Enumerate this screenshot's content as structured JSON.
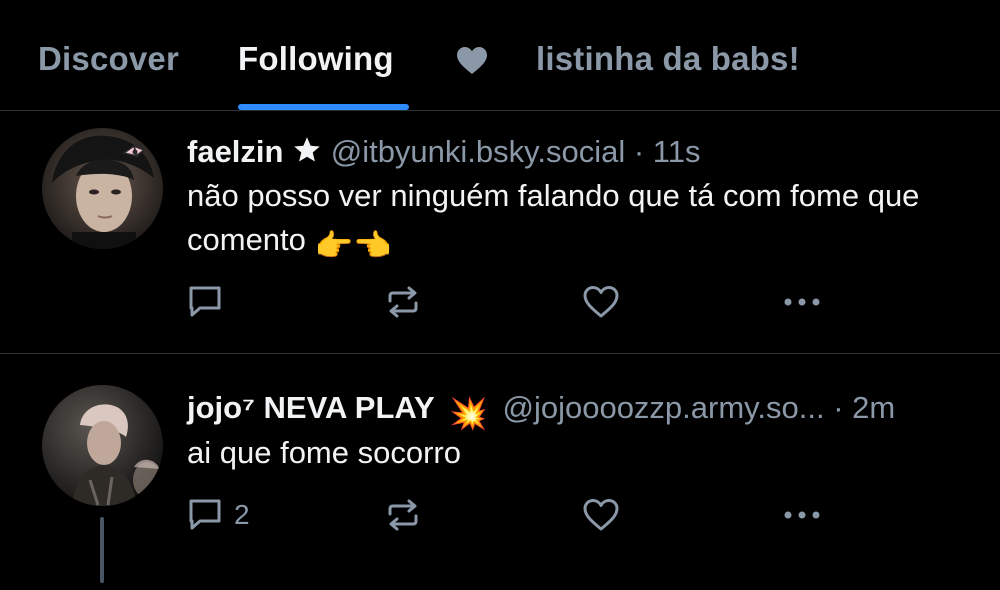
{
  "tabs": {
    "discover": "Discover",
    "following": "Following",
    "heart_icon": "heart-icon",
    "custom_feed": "listinha da babs!"
  },
  "colors": {
    "background": "#000000",
    "accent": "#2f8cff",
    "muted": "#8b98a7",
    "text": "#f1f3f5",
    "divider": "#2a3038"
  },
  "posts": [
    {
      "display_name": "faelzin",
      "badge_icon": "star-icon",
      "handle": "@itbyunki.bsky.social",
      "separator": "·",
      "time": "11s",
      "text": "não posso ver ninguém falando que tá com fome que comento",
      "emoji": "👉👈",
      "reply_count": "",
      "avatar": "avatar-photo"
    },
    {
      "display_name": "jojo⁷ NEVA PLAY",
      "badge_icon": "collision-emoji",
      "badge_emoji": "💥",
      "handle": "@jojoooozzp.army.so...",
      "separator": "·",
      "time": "2m",
      "text": "ai que fome socorro",
      "reply_count": "2",
      "avatar": "avatar-photo"
    }
  ]
}
